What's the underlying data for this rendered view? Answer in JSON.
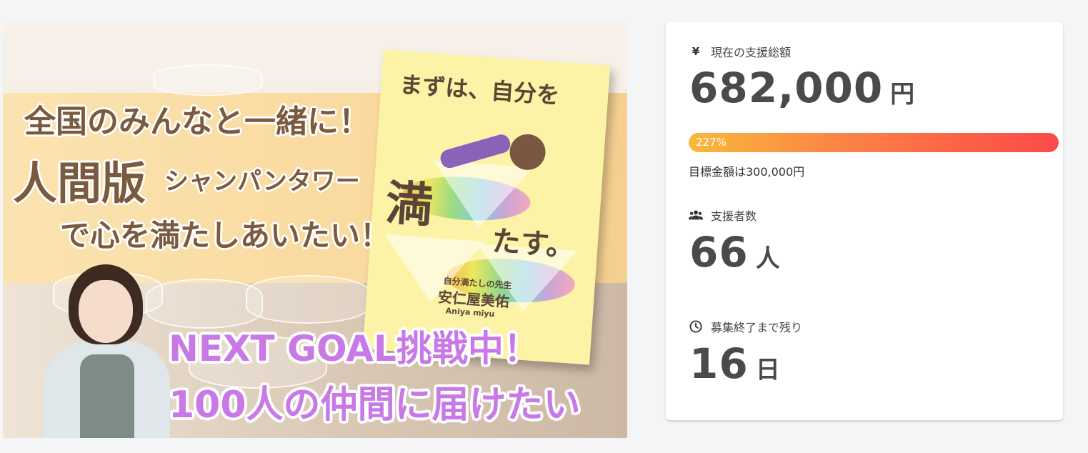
{
  "hero": {
    "headline_line1": "全国のみんなと一緒に！",
    "headline_human": "人間版",
    "headline_tower": "シャンパンタワー",
    "headline_line3": "で心を満たしあいたい！",
    "goal_line1": "NEXT GOAL挑戦中！",
    "goal_line2": "100人の仲間に届けたい",
    "book": {
      "title_top": "まずは、自分を",
      "title_big": "満",
      "title_end": "たす。",
      "author_caption": "自分満たしの先生",
      "author_name": "安仁屋美佑",
      "author_roman": "Aniya miyu"
    }
  },
  "stats": {
    "total": {
      "icon": "yen-icon",
      "label": "現在の支援総額",
      "value": "682,000",
      "unit": "円"
    },
    "progress": {
      "percent_label": "227%",
      "fill_fraction": 1.0,
      "goal_text": "目標金額は300,000円"
    },
    "supporters": {
      "icon": "users-icon",
      "label": "支援者数",
      "value": "66",
      "unit": "人"
    },
    "remaining": {
      "icon": "clock-icon",
      "label": "募集終了まで残り",
      "value": "16",
      "unit": "日"
    }
  },
  "colors": {
    "progress_start": "#f8b93a",
    "progress_end": "#fc4a4a",
    "goal_purple": "#c879e6",
    "headline_brown": "#7a5b40"
  }
}
